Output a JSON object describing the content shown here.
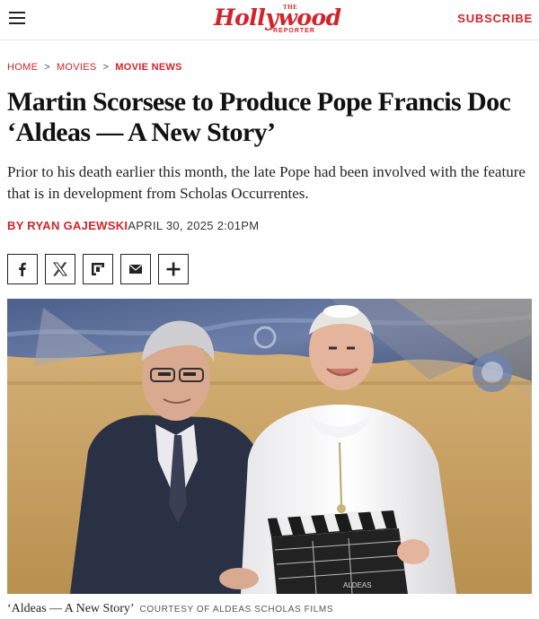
{
  "header": {
    "logo_the": "THE",
    "logo_main": "Hollywood",
    "logo_reporter": "REPORTER",
    "subscribe_label": "SUBSCRIBE"
  },
  "breadcrumb": {
    "items": [
      "HOME",
      "MOVIES",
      "MOVIE NEWS"
    ],
    "separator": ">"
  },
  "article": {
    "headline": "Martin Scorsese to Produce Pope Francis Doc ‘Aldeas — A New Story’",
    "dek": "Prior to his death earlier this month, the late Pope had been involved with the feature that is in development from Scholas Occurrentes.",
    "by_prefix": "BY",
    "author": "RYAN GAJEWSKI",
    "date": "APRIL 30, 2025 2:01PM"
  },
  "share": {
    "buttons": [
      "facebook-icon",
      "x-icon",
      "flipboard-icon",
      "email-icon",
      "plus-icon"
    ]
  },
  "image": {
    "caption_title": "‘Aldeas — A New Story’",
    "caption_credit": "COURTESY OF ALDEAS SCHOLAS FILMS",
    "clapboard_label": "ALDEAS"
  },
  "colors": {
    "brand_red": "#d2232a",
    "text": "#111111"
  }
}
